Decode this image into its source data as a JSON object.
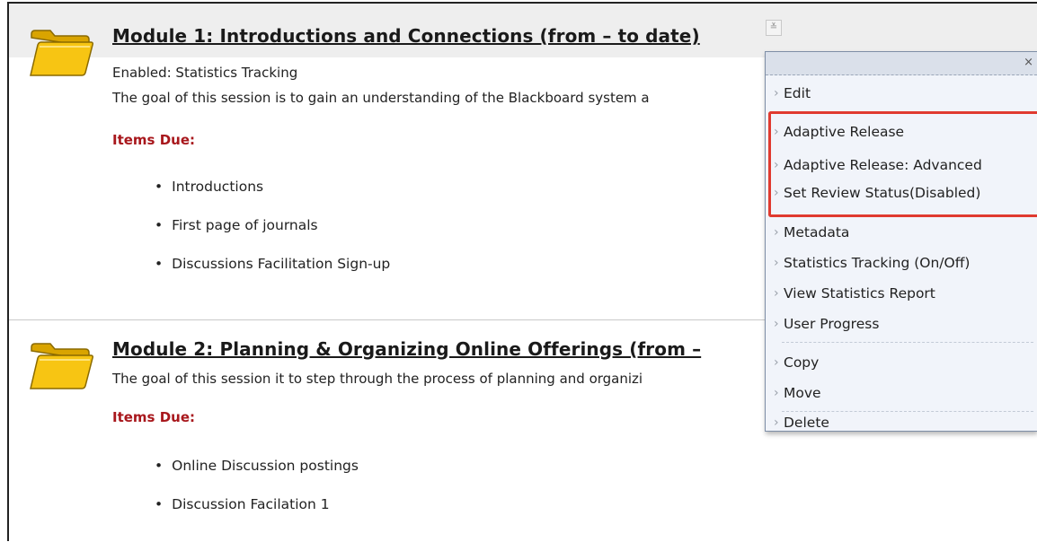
{
  "modules": [
    {
      "title": "Module 1: Introductions and Connections (from – to date)",
      "enabled_line": "Enabled:  Statistics Tracking",
      "description": "The goal of this session is to gain an understanding of the Blackboard system a",
      "items_due_label": "Items Due:",
      "items": [
        "Introductions",
        "First page of journals",
        "Discussions Facilitation Sign-up"
      ]
    },
    {
      "title": "Module 2: Planning & Organizing Online Offerings (from –",
      "description": "The goal of this session it to step through the process of planning and organizi",
      "items_due_label": "Items Due:",
      "items": [
        "Online Discussion postings",
        "Discussion Facilation 1"
      ]
    }
  ],
  "context_menu": {
    "close_glyph": "×",
    "toggle_glyph": "≚",
    "items": [
      "Edit",
      "Adaptive Release",
      "Adaptive Release: Advanced",
      "Set Review Status(Disabled)",
      "Metadata",
      "Statistics Tracking (On/Off)",
      "View Statistics Report",
      "User Progress",
      "Copy",
      "Move",
      "Delete"
    ]
  },
  "colors": {
    "items_due": "#a8171c",
    "highlight_box": "#e03a2f",
    "menu_bg": "#f1f4fa",
    "folder": "#f7c513"
  },
  "icons": [
    "folder-icon",
    "chevron-down-icon",
    "close-icon",
    "chevron-right-icon"
  ]
}
